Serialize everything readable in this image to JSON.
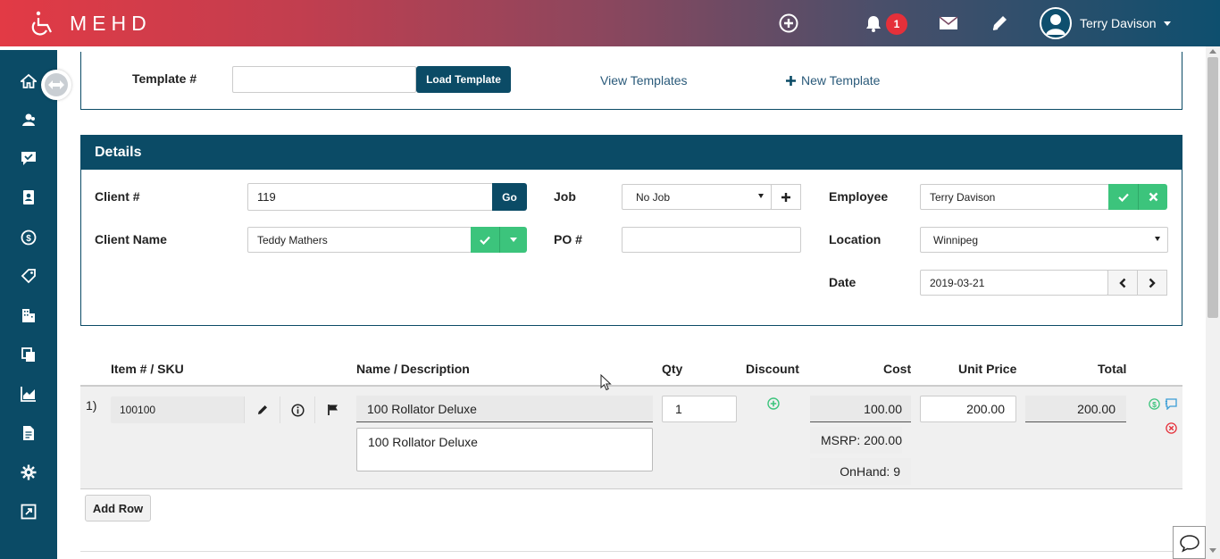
{
  "app": {
    "logo_text": "MEHD"
  },
  "header": {
    "notification_count": "1",
    "user_name": "Terry Davison"
  },
  "template": {
    "label": "Template #",
    "input_value": "",
    "load_button": "Load Template",
    "view_link": "View Templates",
    "new_link": "New Template"
  },
  "details": {
    "title": "Details",
    "client_num_label": "Client #",
    "client_num_value": "119",
    "go_button": "Go",
    "client_name_label": "Client Name",
    "client_name_value": "Teddy Mathers",
    "job_label": "Job",
    "job_value": "No Job",
    "po_label": "PO #",
    "po_value": "",
    "employee_label": "Employee",
    "employee_value": "Terry Davison",
    "location_label": "Location",
    "location_value": "Winnipeg",
    "date_label": "Date",
    "date_value": "2019-03-21"
  },
  "items": {
    "headers": {
      "sku": "Item # / SKU",
      "name": "Name / Description",
      "qty": "Qty",
      "discount": "Discount",
      "cost": "Cost",
      "unit_price": "Unit Price",
      "total": "Total"
    },
    "rows": [
      {
        "index": "1)",
        "sku": "100100",
        "name": "100 Rollator Deluxe",
        "description": "100 Rollator Deluxe",
        "qty": "1",
        "cost": "100.00",
        "msrp": "MSRP: 200.00",
        "onhand": "OnHand: 9",
        "unit_price": "200.00",
        "total": "200.00"
      }
    ],
    "add_row_button": "Add Row"
  },
  "colors": {
    "primary": "#0b4b66",
    "success": "#3cc47c",
    "danger": "#e5303a"
  }
}
